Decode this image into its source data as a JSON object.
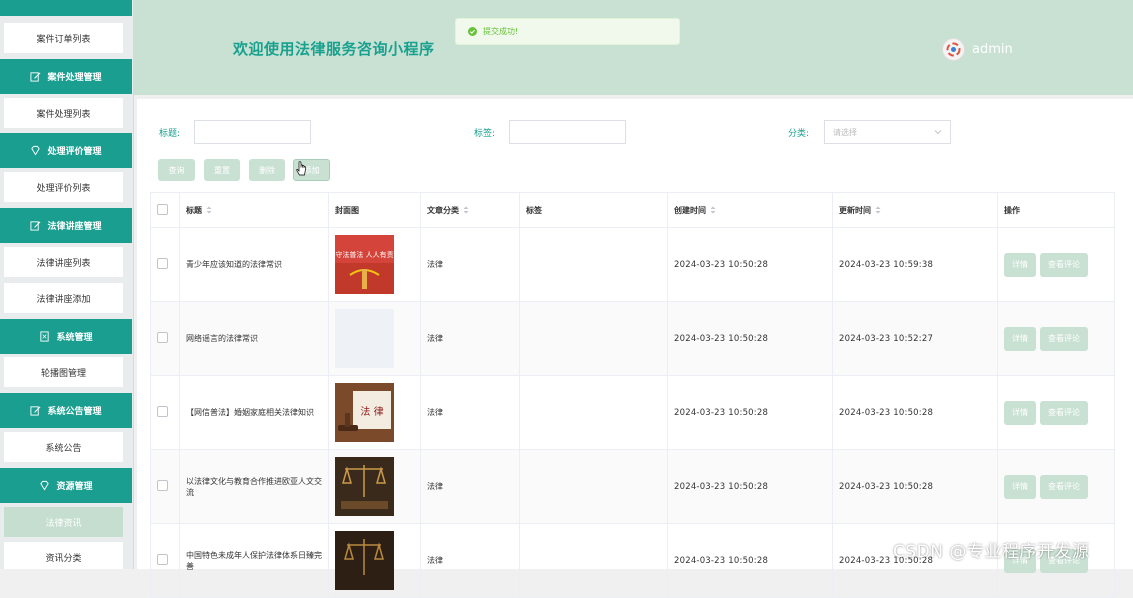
{
  "sidebar": {
    "items": [
      {
        "label": "案件订单列表"
      },
      {
        "label": "案件处理管理"
      },
      {
        "label": "案件处理列表"
      },
      {
        "label": "处理评价管理"
      },
      {
        "label": "处理评价列表"
      },
      {
        "label": "法律讲座管理"
      },
      {
        "label": "法律讲座列表"
      },
      {
        "label": "法律讲座添加"
      },
      {
        "label": "系统管理"
      },
      {
        "label": "轮播图管理"
      },
      {
        "label": "系统公告管理"
      },
      {
        "label": "系统公告"
      },
      {
        "label": "资源管理"
      },
      {
        "label": "法律资讯"
      },
      {
        "label": "资讯分类"
      }
    ]
  },
  "header": {
    "title": "欢迎使用法律服务咨询小程序",
    "toast": "提交成功!",
    "username": "admin"
  },
  "filters": {
    "title_label": "标题:",
    "tag_label": "标签:",
    "category_label": "分类:",
    "category_placeholder": "请选择"
  },
  "toolbar": {
    "query": "查询",
    "reset": "重置",
    "delete": "删除",
    "add": "添加"
  },
  "table": {
    "columns": [
      "标题",
      "封面图",
      "文章分类",
      "标签",
      "创建时间",
      "更新时间",
      "操作"
    ],
    "rows": [
      {
        "title": "青少年应该知道的法律常识",
        "category": "法律",
        "tag": "",
        "created": "2024-03-23 10:50:28",
        "updated": "2024-03-23 10:59:38"
      },
      {
        "title": "网络谣言的法律常识",
        "category": "法律",
        "tag": "",
        "created": "2024-03-23 10:50:28",
        "updated": "2024-03-23 10:52:27"
      },
      {
        "title": "【网信普法】婚姻家庭相关法律知识",
        "category": "法律",
        "tag": "",
        "created": "2024-03-23 10:50:28",
        "updated": "2024-03-23 10:50:28"
      },
      {
        "title": "以法律文化与教育合作推进欧亚人文交流",
        "category": "法律",
        "tag": "",
        "created": "2024-03-23 10:50:28",
        "updated": "2024-03-23 10:50:28"
      },
      {
        "title": "中国特色未成年人保护法律体系日臻完善",
        "category": "法律",
        "tag": "",
        "created": "2024-03-23 10:50:28",
        "updated": "2024-03-23 10:50:28"
      }
    ],
    "detail_label": "详情",
    "comments_label": "查看评论",
    "cover1_text": "守法普法 人人有责",
    "cover3_text": "法 律"
  },
  "watermark": "CSDN @专业程序开发源",
  "colors": {
    "accent": "#1a9e8f",
    "light_accent": "#c9e1d3",
    "success": "#67c23a"
  }
}
